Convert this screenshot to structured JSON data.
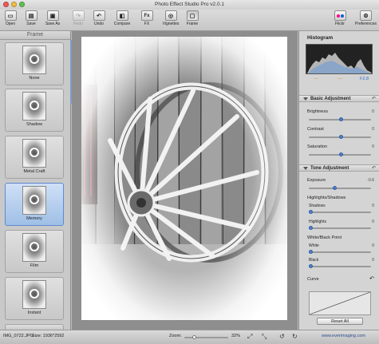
{
  "window": {
    "title": "Photo Effect Studio Pro v2.0.1"
  },
  "toolbar": {
    "items": [
      {
        "label": "Open",
        "icon": "folder-icon"
      },
      {
        "label": "Save",
        "icon": "save-icon"
      },
      {
        "label": "Save As",
        "icon": "save-as-icon"
      },
      {
        "label": "Redo",
        "icon": "redo-icon"
      },
      {
        "label": "Undo",
        "icon": "undo-icon"
      },
      {
        "label": "Compare",
        "icon": "compare-icon"
      },
      {
        "label": "FX",
        "icon": "fx-icon"
      },
      {
        "label": "Vignettes",
        "icon": "vignette-icon"
      },
      {
        "label": "Frame",
        "icon": "frame-icon"
      },
      {
        "label": "Flickr",
        "icon": "flickr-icon"
      },
      {
        "label": "Preferences",
        "icon": "gear-icon"
      }
    ]
  },
  "left_panel": {
    "title": "Frame",
    "frames": [
      "None",
      "Shadow",
      "Metal Craft",
      "Memory",
      "Film",
      "Instant"
    ],
    "selected": "Memory"
  },
  "right_panel": {
    "histogram": {
      "title": "Histogram",
      "readouts": [
        "—",
        "—",
        "F2.8"
      ]
    },
    "basic": {
      "title": "Basic Adjustment",
      "sliders": [
        {
          "label": "Brightness",
          "value": "0"
        },
        {
          "label": "Contrast",
          "value": "0"
        },
        {
          "label": "Saturation",
          "value": "0"
        }
      ]
    },
    "tone": {
      "title": "Tone Adjustment",
      "exposure": {
        "label": "Exposure",
        "value": "-0.6"
      },
      "hs_title": "Highlights/Shadows",
      "shadows": {
        "label": "Shadows",
        "value": "0"
      },
      "highlights": {
        "label": "Highlights",
        "value": "0"
      },
      "wb_title": "White/Black Point",
      "white": {
        "label": "White",
        "value": "0"
      },
      "black": {
        "label": "Black",
        "value": "0"
      },
      "curve": {
        "label": "Curve"
      },
      "reset": {
        "label": "Reset All"
      }
    }
  },
  "status": {
    "filename": "IMG_0722.JPG",
    "size": "Size: 1936*2592",
    "zoom_label": "Zoom:",
    "zoom_value": "32%",
    "site": "www.everimaging.com"
  },
  "colors": {
    "selected_frame": "#9fbfe6",
    "slider_knob": "#4a7fd2"
  }
}
